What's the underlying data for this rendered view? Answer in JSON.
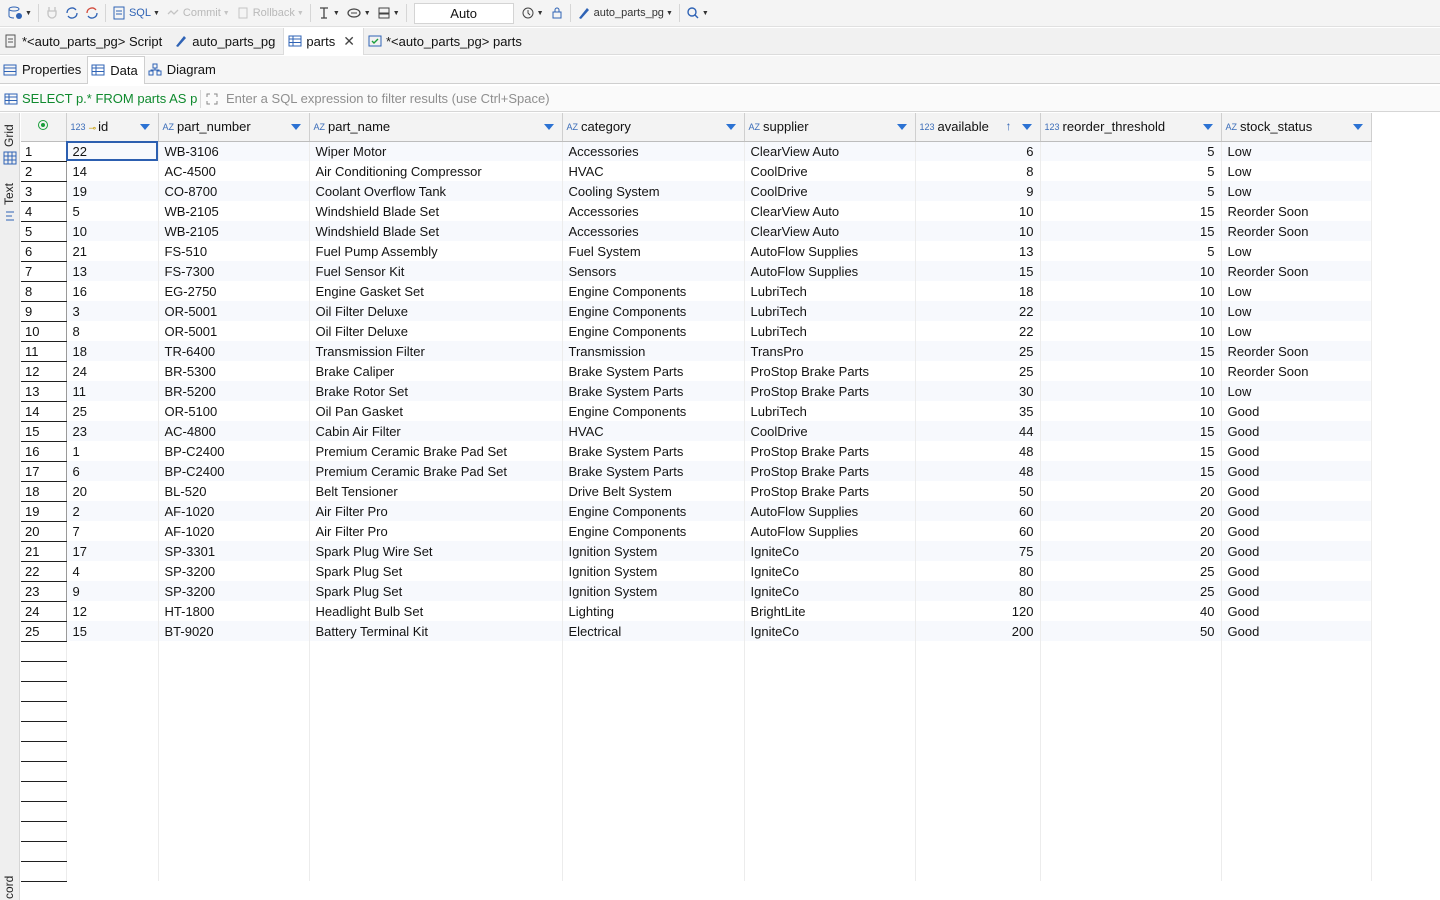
{
  "toolbar": {
    "sql_label": "SQL",
    "commit_label": "Commit",
    "rollback_label": "Rollback",
    "transaction_mode": "Auto",
    "connection_label": "auto_parts_pg"
  },
  "editor_tabs": [
    {
      "label": "*<auto_parts_pg> Script",
      "active": false
    },
    {
      "label": "auto_parts_pg",
      "active": false
    },
    {
      "label": "parts",
      "active": true
    },
    {
      "label": "*<auto_parts_pg> parts",
      "active": false
    }
  ],
  "sub_tabs": [
    {
      "label": "Properties",
      "active": false
    },
    {
      "label": "Data",
      "active": true
    },
    {
      "label": "Diagram",
      "active": false
    }
  ],
  "filter": {
    "sql_text": "SELECT p.* FROM parts AS p",
    "placeholder": "Enter a SQL expression to filter results (use Ctrl+Space)"
  },
  "side_panel": {
    "grid_label": "Grid",
    "text_label": "Text",
    "record_label": "cord"
  },
  "columns": [
    {
      "name": "id",
      "type": "123",
      "key": true
    },
    {
      "name": "part_number",
      "type": "AZ"
    },
    {
      "name": "part_name",
      "type": "AZ"
    },
    {
      "name": "category",
      "type": "AZ"
    },
    {
      "name": "supplier",
      "type": "AZ"
    },
    {
      "name": "available",
      "type": "123",
      "sorted": true
    },
    {
      "name": "reorder_threshold",
      "type": "123"
    },
    {
      "name": "stock_status",
      "type": "AZ"
    }
  ],
  "rows": [
    [
      "1",
      "22",
      "WB-3106",
      "Wiper Motor",
      "Accessories",
      "ClearView Auto",
      "6",
      "5",
      "Low"
    ],
    [
      "2",
      "14",
      "AC-4500",
      "Air Conditioning Compressor",
      "HVAC",
      "CoolDrive",
      "8",
      "5",
      "Low"
    ],
    [
      "3",
      "19",
      "CO-8700",
      "Coolant Overflow Tank",
      "Cooling System",
      "CoolDrive",
      "9",
      "5",
      "Low"
    ],
    [
      "4",
      "5",
      "WB-2105",
      "Windshield Blade Set",
      "Accessories",
      "ClearView Auto",
      "10",
      "15",
      "Reorder Soon"
    ],
    [
      "5",
      "10",
      "WB-2105",
      "Windshield Blade Set",
      "Accessories",
      "ClearView Auto",
      "10",
      "15",
      "Reorder Soon"
    ],
    [
      "6",
      "21",
      "FS-510",
      "Fuel Pump Assembly",
      "Fuel System",
      "AutoFlow Supplies",
      "13",
      "5",
      "Low"
    ],
    [
      "7",
      "13",
      "FS-7300",
      "Fuel Sensor Kit",
      "Sensors",
      "AutoFlow Supplies",
      "15",
      "10",
      "Reorder Soon"
    ],
    [
      "8",
      "16",
      "EG-2750",
      "Engine Gasket Set",
      "Engine Components",
      "LubriTech",
      "18",
      "10",
      "Low"
    ],
    [
      "9",
      "3",
      "OR-5001",
      "Oil Filter Deluxe",
      "Engine Components",
      "LubriTech",
      "22",
      "10",
      "Low"
    ],
    [
      "10",
      "8",
      "OR-5001",
      "Oil Filter Deluxe",
      "Engine Components",
      "LubriTech",
      "22",
      "10",
      "Low"
    ],
    [
      "11",
      "18",
      "TR-6400",
      "Transmission Filter",
      "Transmission",
      "TransPro",
      "25",
      "15",
      "Reorder Soon"
    ],
    [
      "12",
      "24",
      "BR-5300",
      "Brake Caliper",
      "Brake System Parts",
      "ProStop Brake Parts",
      "25",
      "10",
      "Reorder Soon"
    ],
    [
      "13",
      "11",
      "BR-5200",
      "Brake Rotor Set",
      "Brake System Parts",
      "ProStop Brake Parts",
      "30",
      "10",
      "Low"
    ],
    [
      "14",
      "25",
      "OR-5100",
      "Oil Pan Gasket",
      "Engine Components",
      "LubriTech",
      "35",
      "10",
      "Good"
    ],
    [
      "15",
      "23",
      "AC-4800",
      "Cabin Air Filter",
      "HVAC",
      "CoolDrive",
      "44",
      "15",
      "Good"
    ],
    [
      "16",
      "1",
      "BP-C2400",
      "Premium Ceramic Brake Pad Set",
      "Brake System Parts",
      "ProStop Brake Parts",
      "48",
      "15",
      "Good"
    ],
    [
      "17",
      "6",
      "BP-C2400",
      "Premium Ceramic Brake Pad Set",
      "Brake System Parts",
      "ProStop Brake Parts",
      "48",
      "15",
      "Good"
    ],
    [
      "18",
      "20",
      "BL-520",
      "Belt Tensioner",
      "Drive Belt System",
      "ProStop Brake Parts",
      "50",
      "20",
      "Good"
    ],
    [
      "19",
      "2",
      "AF-1020",
      "Air Filter Pro",
      "Engine Components",
      "AutoFlow Supplies",
      "60",
      "20",
      "Good"
    ],
    [
      "20",
      "7",
      "AF-1020",
      "Air Filter Pro",
      "Engine Components",
      "AutoFlow Supplies",
      "60",
      "20",
      "Good"
    ],
    [
      "21",
      "17",
      "SP-3301",
      "Spark Plug Wire Set",
      "Ignition System",
      "IgniteCo",
      "75",
      "20",
      "Good"
    ],
    [
      "22",
      "4",
      "SP-3200",
      "Spark Plug Set",
      "Ignition System",
      "IgniteCo",
      "80",
      "25",
      "Good"
    ],
    [
      "23",
      "9",
      "SP-3200",
      "Spark Plug Set",
      "Ignition System",
      "IgniteCo",
      "80",
      "25",
      "Good"
    ],
    [
      "24",
      "12",
      "HT-1800",
      "Headlight Bulb Set",
      "Lighting",
      "BrightLite",
      "120",
      "40",
      "Good"
    ],
    [
      "25",
      "15",
      "BT-9020",
      "Battery Terminal Kit",
      "Electrical",
      "IgniteCo",
      "200",
      "50",
      "Good"
    ]
  ]
}
